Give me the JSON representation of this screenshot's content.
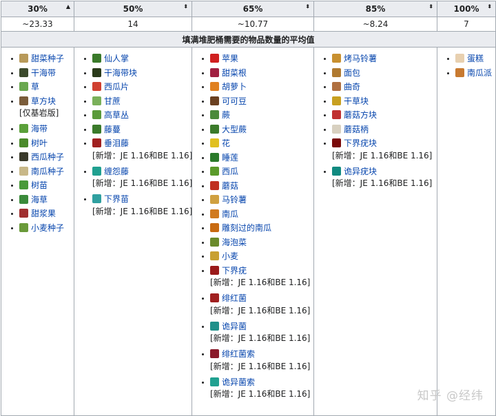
{
  "headers": [
    {
      "label": "30%",
      "sort": "▲"
    },
    {
      "label": "50%",
      "sort": "⬍"
    },
    {
      "label": "65%",
      "sort": "⬍"
    },
    {
      "label": "85%",
      "sort": "⬍"
    },
    {
      "label": "100%",
      "sort": "⬍"
    }
  ],
  "averages": [
    "~23.33",
    "14",
    "~10.77",
    "~8.24",
    "7"
  ],
  "caption": "填满堆肥桶需要的物品数量的平均值",
  "columns": [
    {
      "items": [
        {
          "name": "甜菜种子",
          "icon": "beetroot-seeds-icon",
          "color": "#b89a5a"
        },
        {
          "name": "干海带",
          "icon": "dried-kelp-icon",
          "color": "#3c4a2c"
        },
        {
          "name": "草",
          "icon": "grass-icon",
          "color": "#6aa84f"
        },
        {
          "name": "草方块",
          "icon": "grass-block-icon",
          "color": "#7a5c3a",
          "note": "[仅基岩版]"
        },
        {
          "name": "海带",
          "icon": "kelp-icon",
          "color": "#5aa03a"
        },
        {
          "name": "树叶",
          "icon": "leaves-icon",
          "color": "#4a8a2a"
        },
        {
          "name": "西瓜种子",
          "icon": "melon-seeds-icon",
          "color": "#3a3a2a"
        },
        {
          "name": "南瓜种子",
          "icon": "pumpkin-seeds-icon",
          "color": "#c8b888"
        },
        {
          "name": "树苗",
          "icon": "sapling-icon",
          "color": "#4a9a3a"
        },
        {
          "name": "海草",
          "icon": "seagrass-icon",
          "color": "#3a8a3a"
        },
        {
          "name": "甜浆果",
          "icon": "sweet-berries-icon",
          "color": "#a03030"
        },
        {
          "name": "小麦种子",
          "icon": "wheat-seeds-icon",
          "color": "#6a9a3a"
        }
      ]
    },
    {
      "items": [
        {
          "name": "仙人掌",
          "icon": "cactus-icon",
          "color": "#3a7a2a"
        },
        {
          "name": "干海带块",
          "icon": "dried-kelp-block-icon",
          "color": "#2a3a1a"
        },
        {
          "name": "西瓜片",
          "icon": "melon-slice-icon",
          "color": "#d04030"
        },
        {
          "name": "甘蔗",
          "icon": "sugar-cane-icon",
          "color": "#7ab05a"
        },
        {
          "name": "高草丛",
          "icon": "tall-grass-icon",
          "color": "#5a9a3a"
        },
        {
          "name": "藤蔓",
          "icon": "vines-icon",
          "color": "#3a7a2a"
        },
        {
          "name": "垂泪藤",
          "icon": "weeping-vines-icon",
          "color": "#a02020",
          "note": "[新增：JE 1.16和BE 1.16]"
        },
        {
          "name": "缠怨藤",
          "icon": "twisting-vines-icon",
          "color": "#20a090",
          "note": "[新增：JE 1.16和BE 1.16]"
        },
        {
          "name": "下界苗",
          "icon": "nether-sprouts-icon",
          "color": "#30a0a0",
          "note": "[新增：JE 1.16和BE 1.16]"
        }
      ]
    },
    {
      "items": [
        {
          "name": "苹果",
          "icon": "apple-icon",
          "color": "#d02020"
        },
        {
          "name": "甜菜根",
          "icon": "beetroot-icon",
          "color": "#a02040"
        },
        {
          "name": "胡萝卜",
          "icon": "carrot-icon",
          "color": "#e08020"
        },
        {
          "name": "可可豆",
          "icon": "cocoa-beans-icon",
          "color": "#6a4020"
        },
        {
          "name": "蕨",
          "icon": "fern-icon",
          "color": "#4a8a3a"
        },
        {
          "name": "大型蕨",
          "icon": "large-fern-icon",
          "color": "#3a7a2a"
        },
        {
          "name": "花",
          "icon": "flower-icon",
          "color": "#e0c020"
        },
        {
          "name": "睡莲",
          "icon": "lily-pad-icon",
          "color": "#2a7a2a"
        },
        {
          "name": "西瓜",
          "icon": "melon-icon",
          "color": "#5a9a2a"
        },
        {
          "name": "蘑菇",
          "icon": "mushroom-icon",
          "color": "#c03020"
        },
        {
          "name": "马铃薯",
          "icon": "potato-icon",
          "color": "#d0a040"
        },
        {
          "name": "南瓜",
          "icon": "pumpkin-icon",
          "color": "#d07a20"
        },
        {
          "name": "雕刻过的南瓜",
          "icon": "carved-pumpkin-icon",
          "color": "#c86a10"
        },
        {
          "name": "海泡菜",
          "icon": "sea-pickle-icon",
          "color": "#6a8a2a"
        },
        {
          "name": "小麦",
          "icon": "wheat-icon",
          "color": "#c8a030"
        },
        {
          "name": "下界疣",
          "icon": "nether-wart-icon",
          "color": "#9a1a1a",
          "note": "[新增：JE 1.16和BE 1.16]"
        },
        {
          "name": "绯红菌",
          "icon": "crimson-fungus-icon",
          "color": "#a02020",
          "note": "[新增：JE 1.16和BE 1.16]"
        },
        {
          "name": "诡异菌",
          "icon": "warped-fungus-icon",
          "color": "#20908a",
          "note": "[新增：JE 1.16和BE 1.16]"
        },
        {
          "name": "绯红菌索",
          "icon": "crimson-roots-icon",
          "color": "#8a1a2a",
          "note": "[新增：JE 1.16和BE 1.16]"
        },
        {
          "name": "诡异菌索",
          "icon": "warped-roots-icon",
          "color": "#20a090",
          "note": "[新增：JE 1.16和BE 1.16]"
        }
      ]
    },
    {
      "items": [
        {
          "name": "烤马铃薯",
          "icon": "baked-potato-icon",
          "color": "#c89030"
        },
        {
          "name": "面包",
          "icon": "bread-icon",
          "color": "#b07a30"
        },
        {
          "name": "曲奇",
          "icon": "cookie-icon",
          "color": "#b07040"
        },
        {
          "name": "干草块",
          "icon": "hay-bale-icon",
          "color": "#c8a020"
        },
        {
          "name": "蘑菇方块",
          "icon": "mushroom-block-icon",
          "color": "#c03030"
        },
        {
          "name": "蘑菇柄",
          "icon": "mushroom-stem-icon",
          "color": "#d8d0c0"
        },
        {
          "name": "下界疣块",
          "icon": "nether-wart-block-icon",
          "color": "#7a0a0a",
          "note": "[新增：JE 1.16和BE 1.16]"
        },
        {
          "name": "诡异疣块",
          "icon": "warped-wart-block-icon",
          "color": "#108a80",
          "note": "[新增：JE 1.16和BE 1.16]"
        }
      ]
    },
    {
      "items": [
        {
          "name": "蛋糕",
          "icon": "cake-icon",
          "color": "#e8d0b0"
        },
        {
          "name": "南瓜派",
          "icon": "pumpkin-pie-icon",
          "color": "#c87a30"
        }
      ]
    }
  ],
  "watermark": "知乎 @经纬"
}
